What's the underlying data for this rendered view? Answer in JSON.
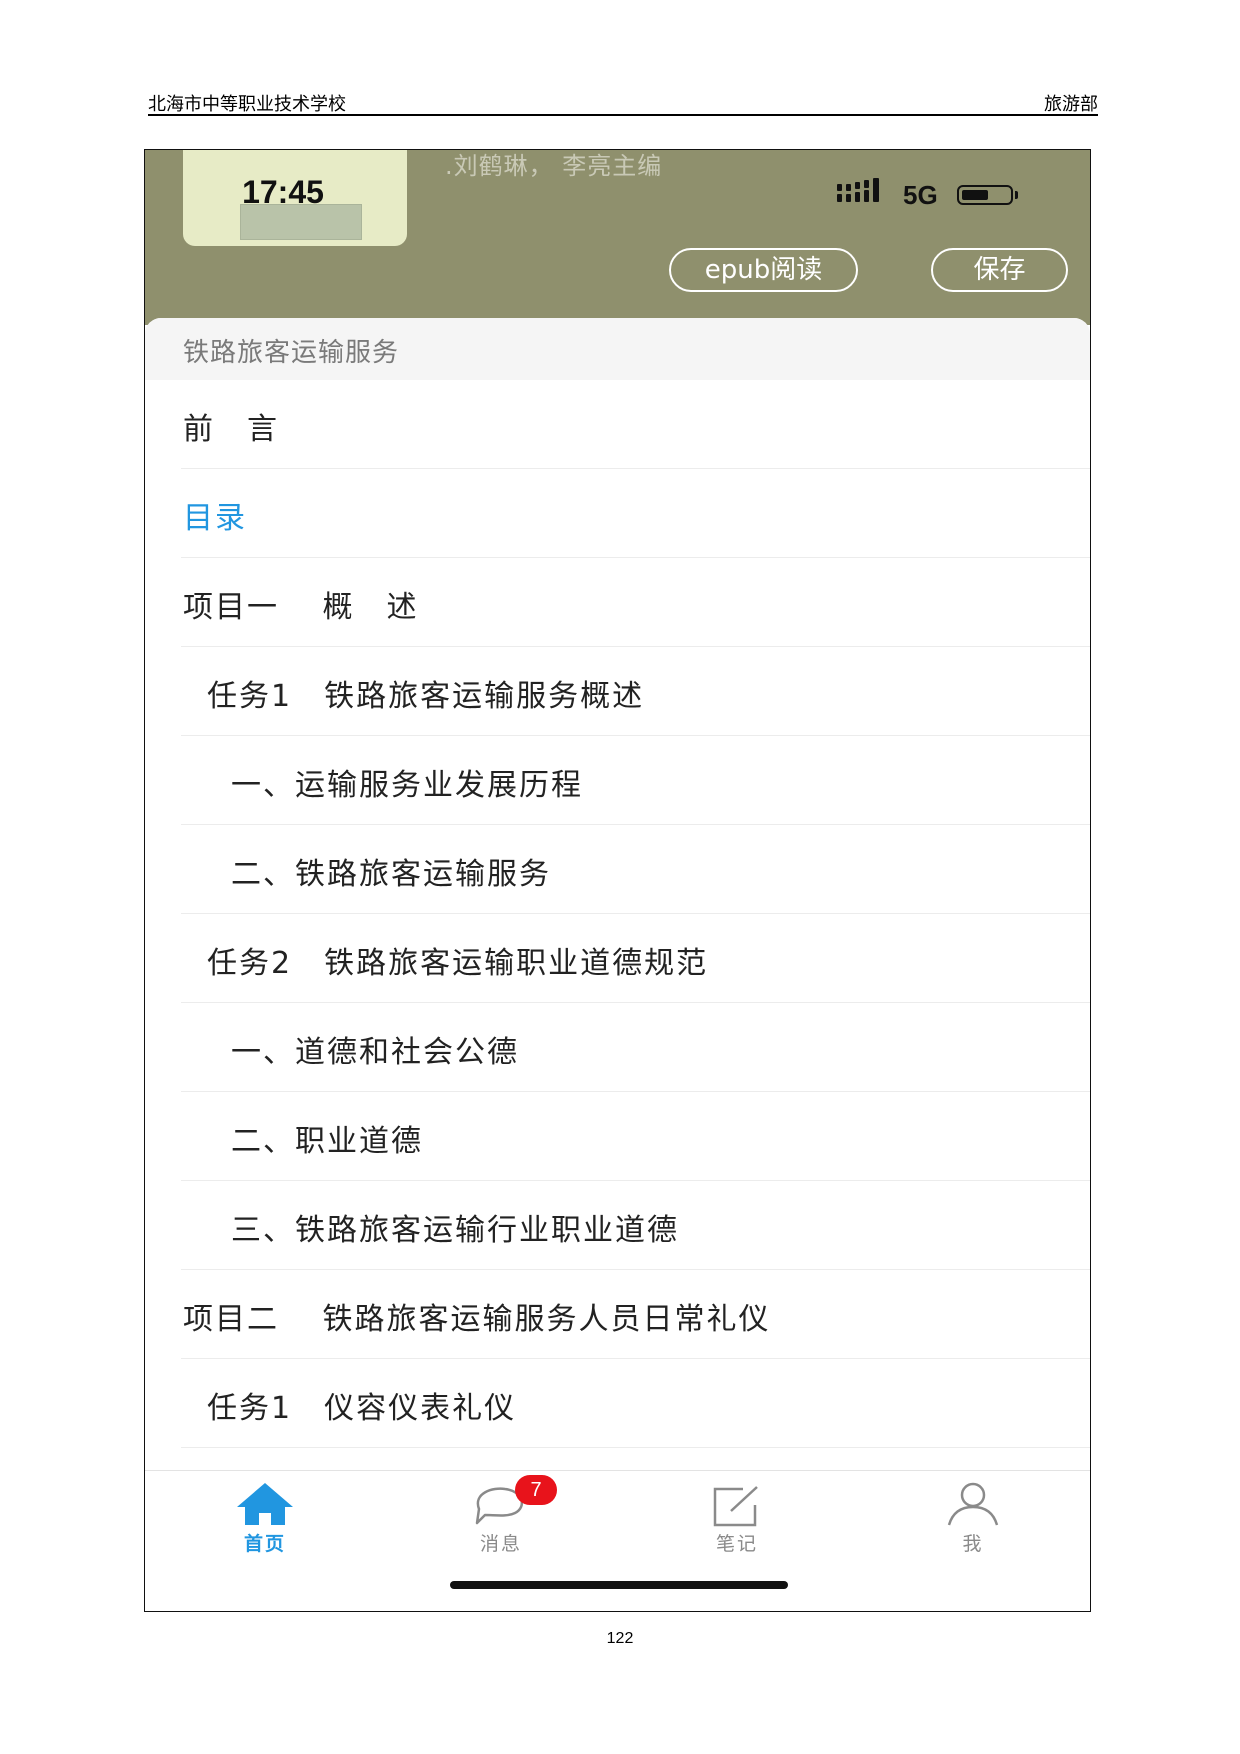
{
  "document": {
    "school": "北海市中等职业技术学校",
    "department": "旅游部",
    "page_number": "122"
  },
  "phone": {
    "status": {
      "time": "17:45",
      "network": "5G"
    },
    "book_credit": ".刘鹤琳， 李亮主编",
    "buttons": {
      "epub": "epub阅读",
      "save": "保存"
    },
    "sheet_title": "铁路旅客运输服务",
    "toc": [
      {
        "label": "前　言",
        "level": 0
      },
      {
        "label": "目录",
        "level": 0,
        "active": true
      },
      {
        "label": "项目一　 概　述",
        "level": 0
      },
      {
        "label": "任务1　铁路旅客运输服务概述",
        "level": 1
      },
      {
        "label": "一、运输服务业发展历程",
        "level": 2
      },
      {
        "label": "二、铁路旅客运输服务",
        "level": 2
      },
      {
        "label": "任务2　铁路旅客运输职业道德规范",
        "level": 1
      },
      {
        "label": "一、道德和社会公德",
        "level": 2
      },
      {
        "label": "二、职业道德",
        "level": 2
      },
      {
        "label": "三、铁路旅客运输行业职业道德",
        "level": 2
      },
      {
        "label": "项目二　 铁路旅客运输服务人员日常礼仪",
        "level": 0
      },
      {
        "label": "任务1　仪容仪表礼仪",
        "level": 1
      }
    ],
    "tabs": [
      {
        "label": "首页",
        "icon": "home-icon",
        "active": true
      },
      {
        "label": "消息",
        "icon": "chat-bubble-icon",
        "badge": "7"
      },
      {
        "label": "笔记",
        "icon": "edit-note-icon"
      },
      {
        "label": "我",
        "icon": "person-icon"
      }
    ],
    "colors": {
      "accent": "#2196e0",
      "header_bg": "#8f906d",
      "badge": "#e8131b"
    }
  }
}
